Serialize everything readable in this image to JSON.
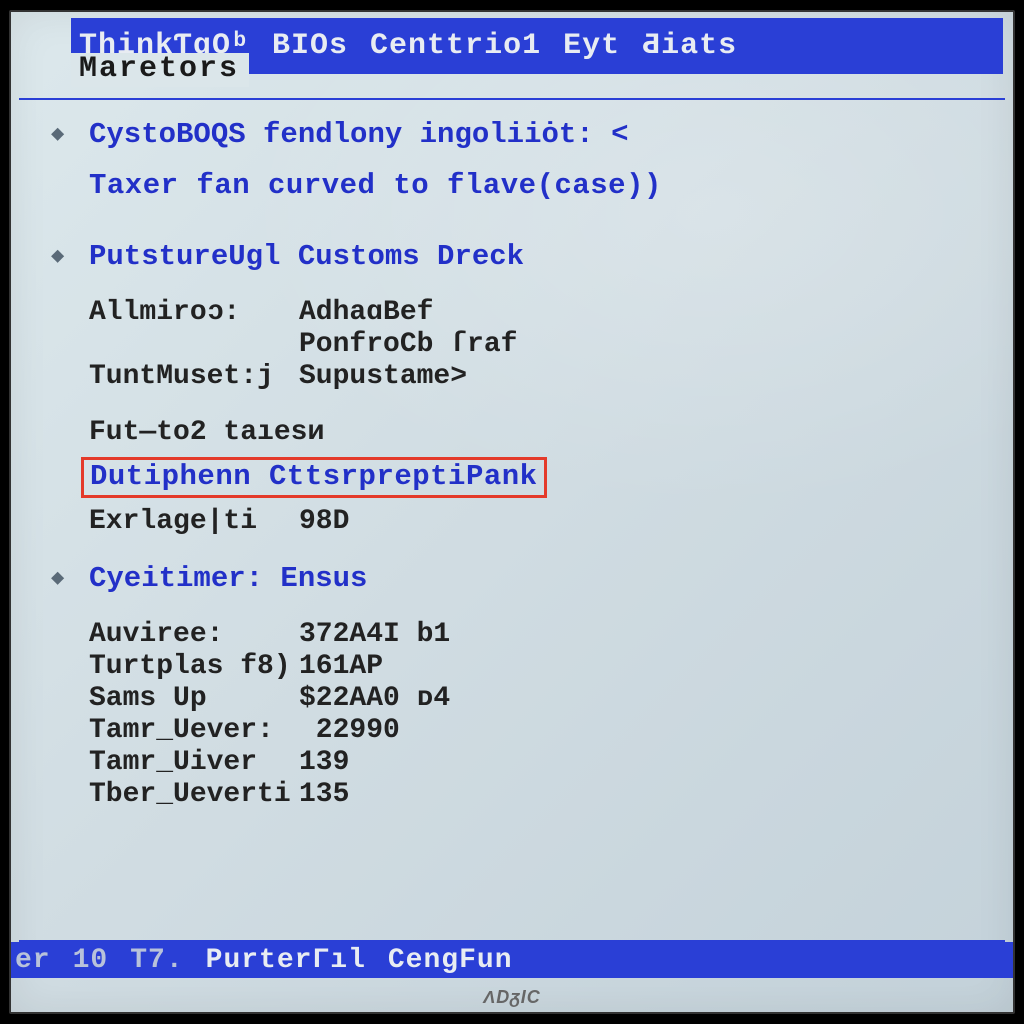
{
  "menubar": {
    "items": [
      "ThinkƬqOᵇ",
      "BIOs",
      "Centtrio1",
      "Eyt",
      "Ƌiats"
    ],
    "active_tab": "Maretors"
  },
  "section1": {
    "head": "CystoBOQS fendlony ingoliiȯt: <",
    "line2": "Taxer fan curved to flave(case))"
  },
  "section2": {
    "head": "PutstureUgl Customs Dreck",
    "rows": [
      {
        "k": "Allmiroᴐ:",
        "v": "AdhaɑBef"
      },
      {
        "k": "",
        "v": "PonfroCb ſraf"
      },
      {
        "k": "TuntMuset:j",
        "v": "Supustame>"
      }
    ],
    "fut": "Fut—to2 taıesᴎ",
    "highlight": "Dutiphenn CttsrpreptiPank",
    "exr": {
      "k": "Exrlage|ti",
      "v": "98D"
    }
  },
  "section3": {
    "head": "Cyeitimer:  Ensus",
    "rows": [
      {
        "k": "Auviree:",
        "v": "372A4I b1"
      },
      {
        "k": "Turtplas f8)",
        "v": "161AP"
      },
      {
        "k": "Sams Up",
        "v": "$22AA0 ᴅ4"
      },
      {
        "k": "Tamr_Uever:",
        "v": " 22990"
      },
      {
        "k": "Tamr_Uiver",
        "v": "139"
      },
      {
        "k": "Tber_Ueverti",
        "v": "135"
      }
    ]
  },
  "footer": {
    "left1": "er",
    "left2": "10",
    "left3": "T7.",
    "items": [
      "PurterГıl",
      "CengFun"
    ]
  },
  "brand": "ΛDᵹIC"
}
